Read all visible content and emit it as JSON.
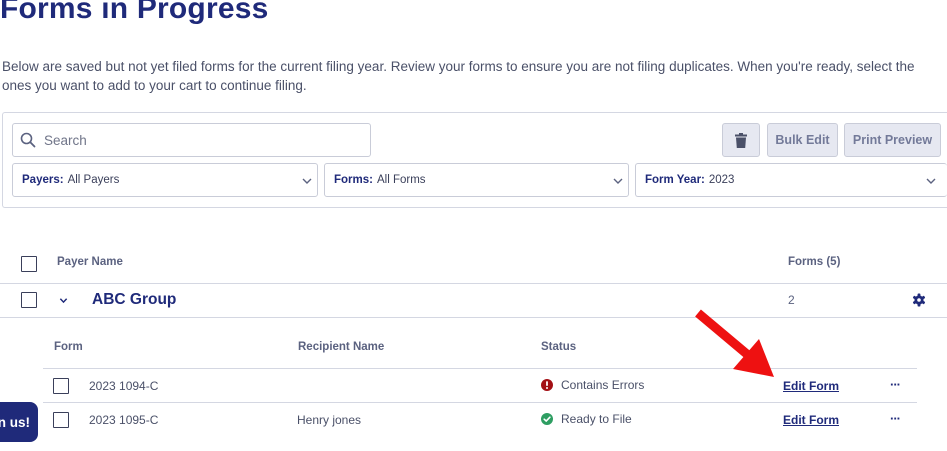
{
  "page": {
    "title": "Forms in Progress",
    "description": "Below are saved but not yet filed forms for the current filing year. Review your forms to ensure you are not filing duplicates. When you're ready, select the ones you want to add to your cart to continue filing."
  },
  "toolbar": {
    "search_placeholder": "Search",
    "bulk_edit_label": "Bulk Edit",
    "print_preview_label": "Print Preview"
  },
  "filters": {
    "payers": {
      "label": "Payers:",
      "value": "All Payers"
    },
    "forms": {
      "label": "Forms:",
      "value": "All Forms"
    },
    "year": {
      "label": "Form Year:",
      "value": "2023"
    }
  },
  "table": {
    "col_payer_name": "Payer Name",
    "col_forms": "Forms (5)",
    "group": {
      "name": "ABC Group",
      "count": "2"
    },
    "sub_cols": {
      "form": "Form",
      "recipient": "Recipient Name",
      "status": "Status"
    },
    "rows": [
      {
        "form": "2023 1094-C",
        "recipient": "",
        "status": "Contains Errors",
        "action": "Edit Form",
        "more": "···"
      },
      {
        "form": "2023 1095-C",
        "recipient": "Henry jones",
        "status": "Ready to File",
        "action": "Edit Form",
        "more": "···"
      }
    ]
  },
  "chat": {
    "label": "n us!"
  },
  "colors": {
    "brand": "#1f2a7a",
    "error": "#a30f14",
    "success": "#2e9e62",
    "annotation_arrow": "#ee1111"
  }
}
